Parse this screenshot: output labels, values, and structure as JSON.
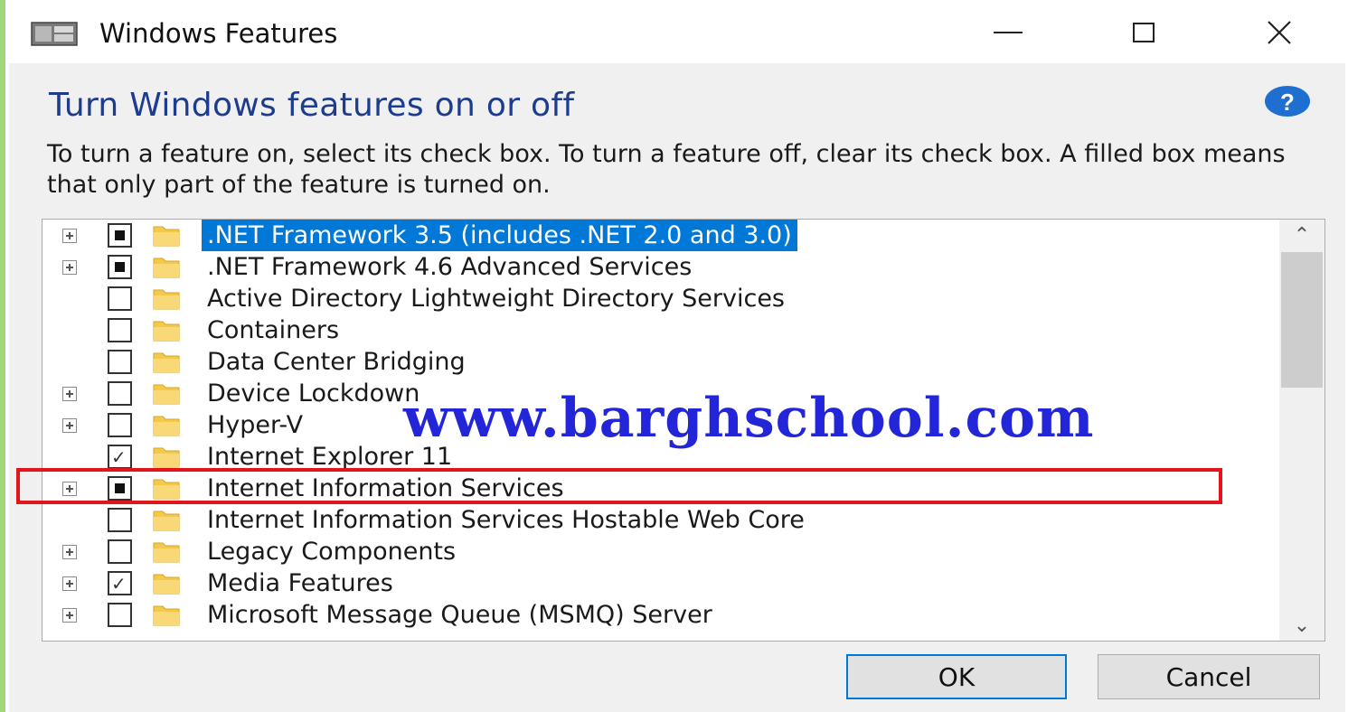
{
  "window": {
    "title": "Windows Features",
    "icon": "windows-features-icon",
    "controls": [
      "minimize-icon",
      "maximize-icon",
      "close-icon"
    ]
  },
  "dialog": {
    "heading": "Turn Windows features on or off",
    "description": "To turn a feature on, select its check box. To turn a feature off, clear its check box. A filled box means that only part of the feature is turned on.",
    "help_icon": "help-icon"
  },
  "features": [
    {
      "label": ".NET Framework 3.5 (includes .NET 2.0 and 3.0)",
      "expandable": true,
      "state": "partial",
      "selected": true
    },
    {
      "label": ".NET Framework 4.6 Advanced Services",
      "expandable": true,
      "state": "partial",
      "selected": false
    },
    {
      "label": "Active Directory Lightweight Directory Services",
      "expandable": false,
      "state": "unchecked",
      "selected": false
    },
    {
      "label": "Containers",
      "expandable": false,
      "state": "unchecked",
      "selected": false
    },
    {
      "label": "Data Center Bridging",
      "expandable": false,
      "state": "unchecked",
      "selected": false
    },
    {
      "label": "Device Lockdown",
      "expandable": true,
      "state": "unchecked",
      "selected": false
    },
    {
      "label": "Hyper-V",
      "expandable": true,
      "state": "unchecked",
      "selected": false
    },
    {
      "label": "Internet Explorer 11",
      "expandable": false,
      "state": "checked",
      "selected": false
    },
    {
      "label": "Internet Information Services",
      "expandable": true,
      "state": "partial",
      "selected": false
    },
    {
      "label": "Internet Information Services Hostable Web Core",
      "expandable": false,
      "state": "unchecked",
      "selected": false
    },
    {
      "label": "Legacy Components",
      "expandable": true,
      "state": "unchecked",
      "selected": false
    },
    {
      "label": "Media Features",
      "expandable": true,
      "state": "checked",
      "selected": false
    },
    {
      "label": "Microsoft Message Queue (MSMQ) Server",
      "expandable": true,
      "state": "unchecked",
      "selected": false
    }
  ],
  "watermark": "www.barghschool.com",
  "buttons": {
    "ok": "OK",
    "cancel": "Cancel"
  },
  "colors": {
    "heading": "#1d3c8f",
    "selection": "#0078d7",
    "highlight_box": "#e4141c",
    "watermark": "#2226d8"
  }
}
